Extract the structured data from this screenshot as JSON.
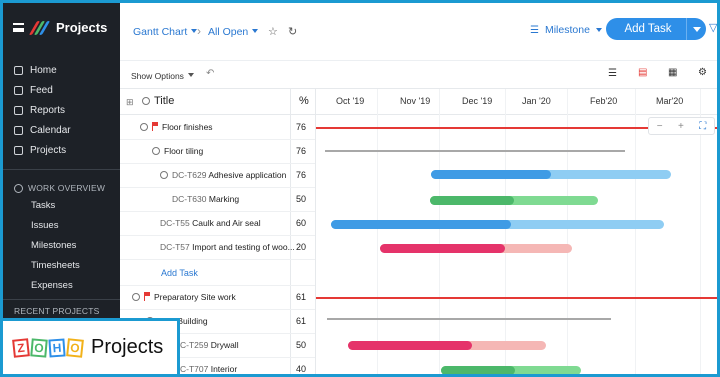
{
  "app": {
    "title": "Projects"
  },
  "sidebar": {
    "nav": [
      {
        "label": "Home",
        "icon": "home-icon"
      },
      {
        "label": "Feed",
        "icon": "feed-icon"
      },
      {
        "label": "Reports",
        "icon": "reports-icon"
      },
      {
        "label": "Calendar",
        "icon": "calendar-icon"
      },
      {
        "label": "Projects",
        "icon": "projects-icon"
      }
    ],
    "work_overview": {
      "title": "WORK OVERVIEW",
      "items": [
        "Tasks",
        "Issues",
        "Milestones",
        "Timesheets",
        "Expenses"
      ]
    },
    "recent_projects": "RECENT PROJECTS"
  },
  "topbar": {
    "view": "Gantt Chart",
    "filter": "All Open",
    "milestone": "Milestone",
    "add_task": "Add Task"
  },
  "options": {
    "show_options": "Show Options"
  },
  "grid": {
    "col_title": "Title",
    "col_pct": "%",
    "months": [
      "Oct '19",
      "Nov '19",
      "Dec '19",
      "Jan '20",
      "Feb'20",
      "Mar'20"
    ],
    "rows": [
      {
        "title": "Floor finishes",
        "pct": "76",
        "type": "milestone"
      },
      {
        "title": "Floor tiling",
        "pct": "76",
        "type": "group"
      },
      {
        "id": "DC-T629",
        "title": "Adhesive application",
        "pct": "76",
        "type": "task-group"
      },
      {
        "id": "DC-T630",
        "title": "Marking",
        "pct": "50",
        "type": "task"
      },
      {
        "id": "DC-T55",
        "title": "Caulk and Air seal",
        "pct": "60",
        "type": "task"
      },
      {
        "id": "DC-T57",
        "title": "Import and testing of woo...",
        "pct": "20",
        "type": "task"
      },
      {
        "title": "Add Task",
        "type": "add"
      },
      {
        "title": "Preparatory Site work",
        "pct": "61",
        "type": "milestone"
      },
      {
        "title": "New Building",
        "pct": "61",
        "type": "group"
      },
      {
        "id": "C-T259",
        "title": "Drywall",
        "pct": "50",
        "type": "task"
      },
      {
        "id": "C-T707",
        "title": "Interior",
        "pct": "40",
        "type": "task"
      }
    ]
  },
  "zoom_controls": {
    "minus": "−",
    "plus": "+"
  },
  "branding": {
    "zoho": "ZOHO",
    "product": "Projects"
  },
  "colors": {
    "sidebar_bg": "#1d2127",
    "accent": "#2e8fe8",
    "blue": "#3f9be5",
    "blue_light": "#8fcdf3",
    "green": "#4cb86a",
    "green_light": "#7fda92",
    "red": "#e5336a",
    "red_light": "#f5b7b5",
    "milestone_line": "#e53935"
  }
}
